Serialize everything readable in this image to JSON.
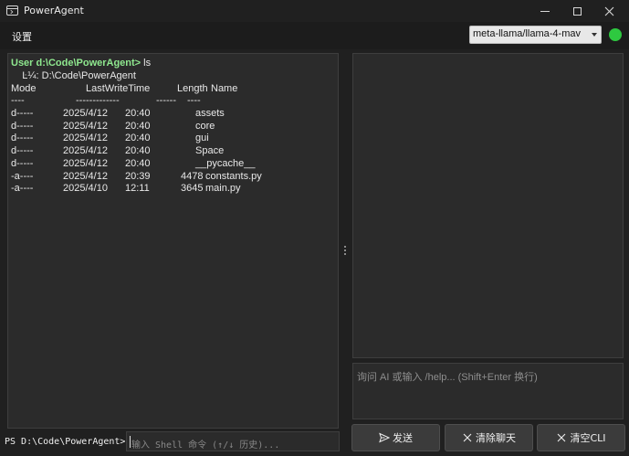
{
  "window": {
    "title": "PowerAgent"
  },
  "menu": {
    "settings": "设置"
  },
  "model": {
    "selected": "meta-llama/llama-4-mav",
    "status_color": "#2ec940"
  },
  "terminal": {
    "prompt_user": "User d:\\Code\\PowerAgent>",
    "command": " ls",
    "dir_line": "    Ŀ¼: D:\\Code\\PowerAgent",
    "headers": {
      "mode": "Mode",
      "lwt": "LastWriteTime",
      "length": "Length",
      "name": "Name"
    },
    "sep": {
      "mode": "----",
      "lwt": "-------------",
      "length": "------",
      "name": "----"
    },
    "rows": [
      {
        "mode": "d-----",
        "date": "2025/4/12",
        "time": "20:40",
        "length": "",
        "name": "assets"
      },
      {
        "mode": "d-----",
        "date": "2025/4/12",
        "time": "20:40",
        "length": "",
        "name": "core"
      },
      {
        "mode": "d-----",
        "date": "2025/4/12",
        "time": "20:40",
        "length": "",
        "name": "gui"
      },
      {
        "mode": "d-----",
        "date": "2025/4/12",
        "time": "20:40",
        "length": "",
        "name": "Space"
      },
      {
        "mode": "d-----",
        "date": "2025/4/12",
        "time": "20:40",
        "length": "",
        "name": "__pycache__"
      },
      {
        "mode": "-a----",
        "date": "2025/4/12",
        "time": "20:39",
        "length": "4478",
        "name": "constants.py"
      },
      {
        "mode": "-a----",
        "date": "2025/4/10",
        "time": "12:11",
        "length": "3645",
        "name": "main.py"
      }
    ]
  },
  "chat": {
    "input_placeholder": "询问 AI 或输入 /help... (Shift+Enter 换行)"
  },
  "shell": {
    "ps_prompt": "PS D:\\Code\\PowerAgent>",
    "placeholder": "输入 Shell 命令 (↑/↓ 历史)..."
  },
  "buttons": {
    "send": "发送",
    "clear_chat": "清除聊天",
    "clear_cli": "清空CLI"
  },
  "icons": {
    "app": "terminal-window-icon",
    "send": "paper-plane-icon",
    "clear": "x-icon"
  }
}
